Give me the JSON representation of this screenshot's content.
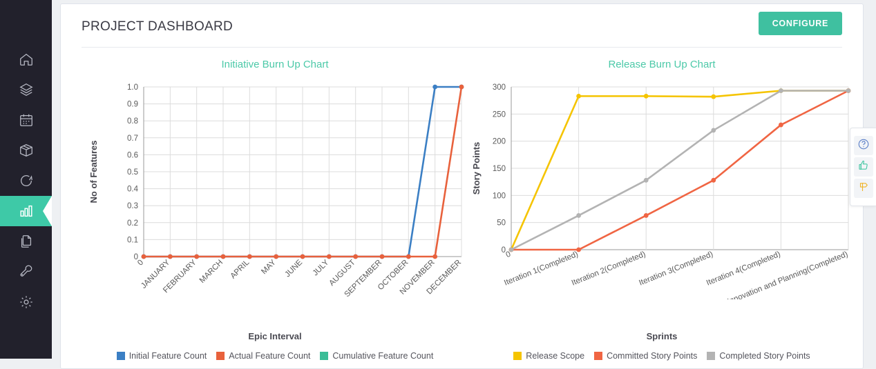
{
  "sidebar": {
    "items": [
      {
        "name": "home",
        "icon": "home-icon",
        "active": false
      },
      {
        "name": "layers",
        "icon": "layers-icon",
        "active": false
      },
      {
        "name": "calendar",
        "icon": "calendar-icon",
        "active": false
      },
      {
        "name": "package",
        "icon": "package-icon",
        "active": false
      },
      {
        "name": "refresh",
        "icon": "refresh-icon",
        "active": false
      },
      {
        "name": "reports",
        "icon": "bar-chart-icon",
        "active": true
      },
      {
        "name": "documents",
        "icon": "documents-icon",
        "active": false
      },
      {
        "name": "tools",
        "icon": "wrench-icon",
        "active": false
      },
      {
        "name": "settings",
        "icon": "gear-icon",
        "active": false
      }
    ]
  },
  "header": {
    "title": "PROJECT DASHBOARD",
    "configure_label": "CONFIGURE"
  },
  "help_dock": {
    "buttons": [
      {
        "name": "help-icon",
        "glyph": "?"
      },
      {
        "name": "thumbs-up-icon",
        "glyph": "ὄd"
      },
      {
        "name": "feedback-flag-icon",
        "glyph": "flag"
      }
    ]
  },
  "colors": {
    "accent": "#3fc0a0",
    "title": "#4cc9a8",
    "blue": "#3b7fc4",
    "orange": "#e8613c",
    "teal": "#3bbd97",
    "yellow": "#f5c400",
    "orange2": "#f06543",
    "grey": "#b3b3b3",
    "sidebar": "#22212c"
  },
  "chart_data": [
    {
      "type": "line",
      "title": "Initiative Burn Up Chart",
      "xlabel": "Epic Interval",
      "ylabel": "No of Features",
      "categories": [
        "0",
        "JANUARY",
        "FEBRUARY",
        "MARCH",
        "APRIL",
        "MAY",
        "JUNE",
        "JULY",
        "AUGUST",
        "SEPTEMBER",
        "OCTOBER",
        "NOVEMBER",
        "DECEMBER"
      ],
      "ytick_labels": [
        "0",
        "0.1",
        "0.2",
        "0.3",
        "0.4",
        "0.5",
        "0.6",
        "0.7",
        "0.8",
        "0.9",
        "1.0"
      ],
      "ylim": [
        0,
        1.0
      ],
      "grid": true,
      "legend_position": "bottom",
      "series": [
        {
          "name": "Initial Feature Count",
          "color": "#3b7fc4",
          "values": [
            0,
            0,
            0,
            0,
            0,
            0,
            0,
            0,
            0,
            0,
            0,
            1.0,
            1.0
          ]
        },
        {
          "name": "Actual Feature Count",
          "color": "#e8613c",
          "values": [
            0,
            0,
            0,
            0,
            0,
            0,
            0,
            0,
            0,
            0,
            0,
            0,
            1.0
          ]
        },
        {
          "name": "Cumulative Feature Count",
          "color": "#3bbd97",
          "values": []
        }
      ]
    },
    {
      "type": "line",
      "title": "Release Burn Up Chart",
      "xlabel": "Sprints",
      "ylabel": "Story Points",
      "categories": [
        "0",
        "Iteration 1(Completed)",
        "Iteration 2(Completed)",
        "Iteration 3(Completed)",
        "Iteration 4(Completed)",
        "Innovation and Planning(Completed)"
      ],
      "ytick_labels": [
        "0",
        "50",
        "100",
        "150",
        "200",
        "250",
        "300"
      ],
      "ylim": [
        0,
        300
      ],
      "grid": true,
      "legend_position": "bottom",
      "series": [
        {
          "name": "Release Scope",
          "color": "#f5c400",
          "values": [
            0,
            283,
            283,
            282,
            293,
            293
          ]
        },
        {
          "name": "Committed Story Points",
          "color": "#f06543",
          "values": [
            0,
            0,
            63,
            128,
            230,
            293
          ]
        },
        {
          "name": "Completed Story Points",
          "color": "#b3b3b3",
          "values": [
            0,
            63,
            128,
            220,
            293,
            293
          ]
        }
      ]
    }
  ]
}
